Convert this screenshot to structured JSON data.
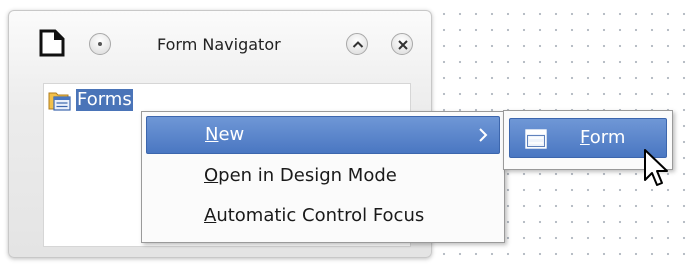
{
  "window": {
    "title": "Form Navigator"
  },
  "tree": {
    "root_label": "Forms"
  },
  "context_menu": {
    "items": [
      {
        "mnemonic": "N",
        "rest": "ew",
        "has_submenu": true,
        "highlighted": true
      },
      {
        "mnemonic": "O",
        "rest": "pen in Design Mode",
        "has_submenu": false,
        "highlighted": false
      },
      {
        "mnemonic": "A",
        "rest": "utomatic Control Focus",
        "has_submenu": false,
        "highlighted": false
      }
    ]
  },
  "submenu": {
    "items": [
      {
        "mnemonic": "F",
        "rest": "orm",
        "icon": "form-icon",
        "highlighted": true
      }
    ]
  },
  "icons": {
    "app": "document-icon",
    "menu": "window-menu-icon",
    "shade": "chevron-up-icon",
    "close": "close-icon",
    "tree": "forms-folder-icon",
    "submenu_arrow": "chevron-right-icon",
    "cursor": "mouse-pointer-icon"
  },
  "colors": {
    "highlight": "#4a77c2",
    "selection": "#4a74b8",
    "menu_background": "#fbfbfb",
    "grid_dot": "#b4bac3"
  }
}
